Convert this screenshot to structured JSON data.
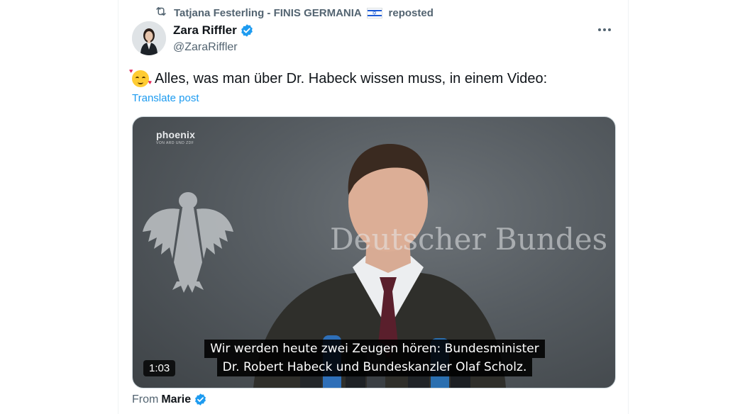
{
  "repost": {
    "text": "Tatjana Festerling - FINIS GERMANIA",
    "suffix": "reposted",
    "flag_icon": "israel-flag"
  },
  "author": {
    "name": "Zara Riffler",
    "handle": "@ZaraRiffler",
    "verified_color": "#1d9bf0"
  },
  "post": {
    "emoji": "smiling-face-with-hearts",
    "text": "Alles, was man über Dr. Habeck wissen muss, in einem Video:",
    "translate_label": "Translate post"
  },
  "video": {
    "channel_logo": "phoenix",
    "channel_sub": "VON ARD UND ZDF",
    "background_text": "Deutscher Bundes",
    "subtitle_line1": "Wir werden heute zwei Zeugen hören: Bundesminister",
    "subtitle_line2": "Dr. Robert Habeck und Bundeskanzler Olaf Scholz.",
    "duration": "1:03"
  },
  "attribution": {
    "prefix": "From",
    "name": "Marie"
  },
  "colors": {
    "accent": "#1d9bf0",
    "secondary_text": "#536471",
    "primary_text": "#0f1419"
  }
}
